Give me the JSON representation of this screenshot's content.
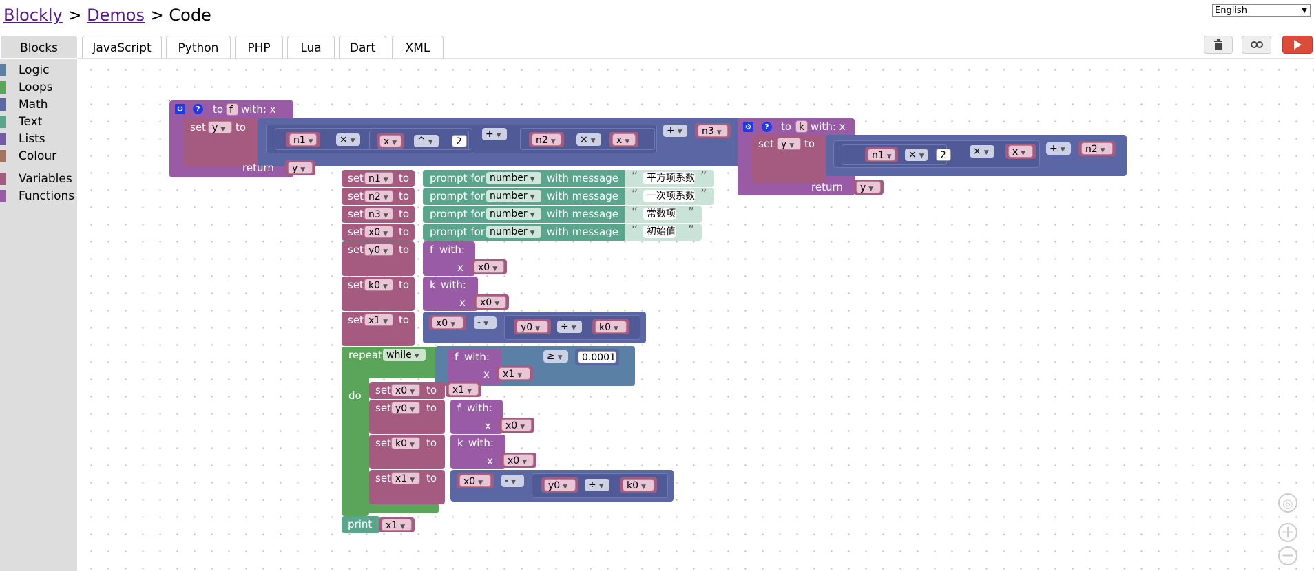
{
  "header": {
    "crumb_blockly": "Blockly",
    "sep1": ">",
    "crumb_demos": "Demos",
    "sep2": ">",
    "page": "Code"
  },
  "language_select": {
    "value": "English"
  },
  "tabs": [
    "Blocks",
    "JavaScript",
    "Python",
    "PHP",
    "Lua",
    "Dart",
    "XML"
  ],
  "toolbar_icons": [
    "trash-icon",
    "link-icon",
    "run-icon"
  ],
  "toolbox": [
    {
      "label": "Logic",
      "color": "#5b80a5"
    },
    {
      "label": "Loops",
      "color": "#5ba55b"
    },
    {
      "label": "Math",
      "color": "#5b67a5"
    },
    {
      "label": "Text",
      "color": "#5ba58c"
    },
    {
      "label": "Lists",
      "color": "#745ba5"
    },
    {
      "label": "Colour",
      "color": "#a5745b"
    },
    {
      "label": "Variables",
      "color": "#a55b80"
    },
    {
      "label": "Functions",
      "color": "#995ba5"
    }
  ],
  "text": {
    "to": "to",
    "with_x": "with: x",
    "set": "set",
    "return": "return",
    "prompt_for": "prompt for",
    "with_message": "with message",
    "with": "with:",
    "x": "x",
    "repeat": "repeat",
    "do": "do",
    "print": "print",
    "open_quote": "“",
    "close_quote": "”"
  },
  "vars": {
    "f": "f",
    "k": "k",
    "y": "y",
    "x": "x",
    "n1": "n1",
    "n2": "n2",
    "n3": "n3",
    "x0": "x0",
    "y0": "y0",
    "k0": "k0",
    "x1": "x1"
  },
  "ops": {
    "times": "×",
    "power": "^",
    "plus": "+",
    "minus": "-",
    "divide": "÷",
    "gte": "≥"
  },
  "values": {
    "two": "2",
    "tolerance": "0.0001"
  },
  "dropdowns": {
    "number": "number",
    "while": "while"
  },
  "prompts": [
    "平方项系数",
    "一次项系数",
    "常数项",
    "初始值"
  ]
}
